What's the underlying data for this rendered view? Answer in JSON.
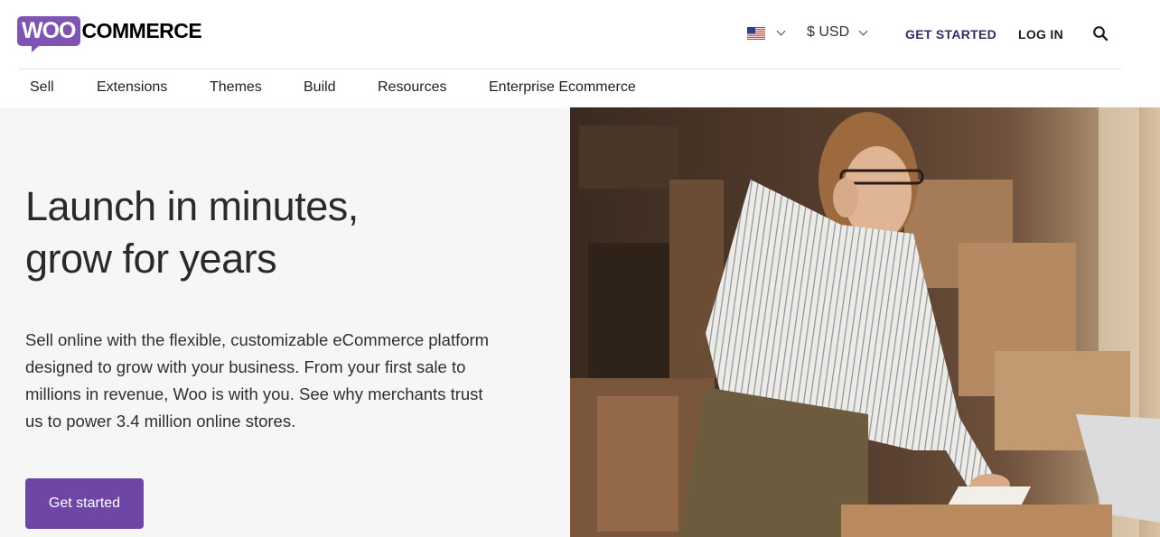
{
  "header": {
    "logo": {
      "woo": "WOO",
      "commerce": "COMMERCE"
    },
    "flag_icon": "us-flag-icon",
    "currency": "$ USD",
    "get_started_link": "GET STARTED",
    "login_link": "LOG IN",
    "search_icon": "search-icon"
  },
  "nav": {
    "items": [
      {
        "label": "Sell",
        "has_dropdown": true
      },
      {
        "label": "Extensions",
        "has_dropdown": true
      },
      {
        "label": "Themes",
        "has_dropdown": true
      },
      {
        "label": "Build",
        "has_dropdown": true
      },
      {
        "label": "Resources",
        "has_dropdown": true
      },
      {
        "label": "Enterprise Ecommerce",
        "has_dropdown": false
      }
    ]
  },
  "hero": {
    "title_line1": "Launch in minutes,",
    "title_line2": "grow for years",
    "description": "Sell online with the flexible, customizable eCommerce platform designed to grow with your business. From your first sale to millions in revenue, Woo is with you. See why merchants trust us to power 3.4 million online stores.",
    "cta_label": "Get started"
  },
  "colors": {
    "brand_purple": "#7f54b3",
    "button_purple": "#6e46a5",
    "hero_bg": "#f5f6f5"
  }
}
